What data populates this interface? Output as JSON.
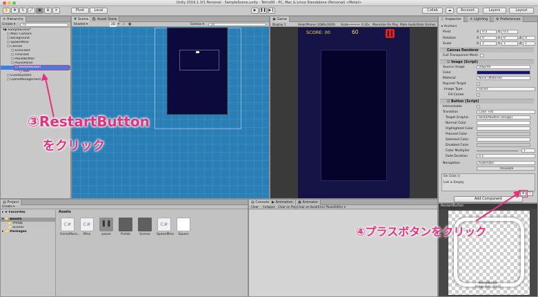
{
  "window": {
    "title": "Unity 2019.1.1f1 Personal - SampleScene.unity - Tetris00 - PC, Mac & Linux Standalone (Personal) <Metal>"
  },
  "toolbar": {
    "pivot_label": "Pivot",
    "local_label": "Local",
    "collab_label": "Collab",
    "account_label": "Account",
    "layers_label": "Layers",
    "layout_label": "Layout"
  },
  "hierarchy": {
    "tab_label": "Hierarchy",
    "create_label": "Create",
    "search_placeholder": "All",
    "items": [
      {
        "label": "SampleScene*",
        "indent": 0
      },
      {
        "label": "Main Camera",
        "indent": 1
      },
      {
        "label": "Background",
        "indent": 1
      },
      {
        "label": "SpawnMino",
        "indent": 1
      },
      {
        "label": "Canvas",
        "indent": 1
      },
      {
        "label": "ScoreText",
        "indent": 2
      },
      {
        "label": "TimeText",
        "indent": 2
      },
      {
        "label": "PauseButton",
        "indent": 2
      },
      {
        "label": "PausePanel",
        "indent": 2
      },
      {
        "label": "RestartButton",
        "indent": 3
      },
      {
        "label": "Text",
        "indent": 4
      },
      {
        "label": "EventSystem",
        "indent": 1
      },
      {
        "label": "GameManagement",
        "indent": 1
      }
    ],
    "selected_index": 9
  },
  "scene": {
    "tab_scene": "Scene",
    "tab_asset_store": "Asset Store",
    "shaded_label": "Shaded",
    "mode_2d": "2D",
    "gizmos_label": "Gizmos",
    "search_placeholder": "All"
  },
  "game": {
    "tab_label": "Game",
    "display_label": "Display 1",
    "resolution_label": "SmartPhone (1080x1920)",
    "scale_label": "Scale",
    "scale_value": "0.32x",
    "maximize_label": "Maximize On Play",
    "mute_label": "Mute Audio",
    "stats_label": "Stats",
    "gizmos_label": "Gizmos",
    "score_text": "SCORE: 00",
    "time_text": "60"
  },
  "inspector": {
    "tab_inspector": "Inspector",
    "tab_lighting": "Lighting",
    "tab_preferences": "Preferences",
    "anchors_label": "Anchors",
    "pivot_label": "Pivot",
    "pivot_x": "0.5",
    "pivot_y": "0.5",
    "rotation_label": "Rotation",
    "rot_x": "0",
    "rot_y": "0",
    "rot_z": "0",
    "scale_label": "Scale",
    "scale_x": "1",
    "scale_y": "1",
    "scale_z": "1",
    "canvas_renderer_label": "Canvas Renderer",
    "cull_label": "Cull Transparent Mesh",
    "image_label": "Image (Script)",
    "source_image_label": "Source Image",
    "source_image_value": "UISprite",
    "color_label": "Color",
    "material_label": "Material",
    "material_value": "None (Material)",
    "raycast_label": "Raycast Target",
    "image_type_label": "Image Type",
    "image_type_value": "Sliced",
    "fill_center_label": "Fill Center",
    "button_label": "Button (Script)",
    "interactable_label": "Interactable",
    "transition_label": "Transition",
    "transition_value": "Color Tint",
    "target_graphic_label": "Target Graphic",
    "target_graphic_value": "RestartButton (Image)",
    "normal_color_label": "Normal Color",
    "highlighted_color_label": "Highlighted Color",
    "pressed_color_label": "Pressed Color",
    "selected_color_label": "Selected Color",
    "disabled_color_label": "Disabled Color",
    "color_multiplier_label": "Color Multiplier",
    "color_multiplier_value": "1",
    "fade_duration_label": "Fade Duration",
    "fade_duration_value": "0.1",
    "navigation_label": "Navigation",
    "navigation_value": "Automatic",
    "visualize_label": "Visualize",
    "onclick_label": "On Click ()",
    "list_empty_label": "List is Empty",
    "plus_label": "+",
    "minus_label": "-",
    "add_component_label": "Add Component"
  },
  "project": {
    "tab_project": "Project",
    "create_label": "Create",
    "favorites_label": "Favorites",
    "assets_label": "Assets",
    "prefab_label": "Prefab",
    "scenes_label": "Scenes",
    "packages_label": "Packages",
    "breadcrumb": "Assets",
    "assets": [
      "GameMana...",
      "Mino",
      "pause",
      "Prefab",
      "Scenes",
      "SpawnMino",
      "Square"
    ]
  },
  "console": {
    "tab_console": "Console",
    "tab_animation": "Animation",
    "tab_animator": "Animator",
    "clear_label": "Clear",
    "collapse_label": "Collapse",
    "clear_on_play_label": "Clear on Play",
    "clear_on_build_label": "Clear on Build",
    "error_pause_label": "Error Pause",
    "editor_label": "Editor"
  },
  "preview": {
    "title": "RestartButton",
    "caption": "RestartButton\nImage Size: 32x32"
  },
  "annotations": {
    "step3_line1": "③RestartButton",
    "step3_line2": "をクリック",
    "step4": "④プラスボタンをクリック"
  },
  "colors": {
    "callout": "#e8317a",
    "scene_bg": "#2b7fb7",
    "game_bg": "#3a3a3a",
    "canvas_navy": "#0c0a3d",
    "selection": "#3d80df",
    "pause_red": "#e02222"
  }
}
